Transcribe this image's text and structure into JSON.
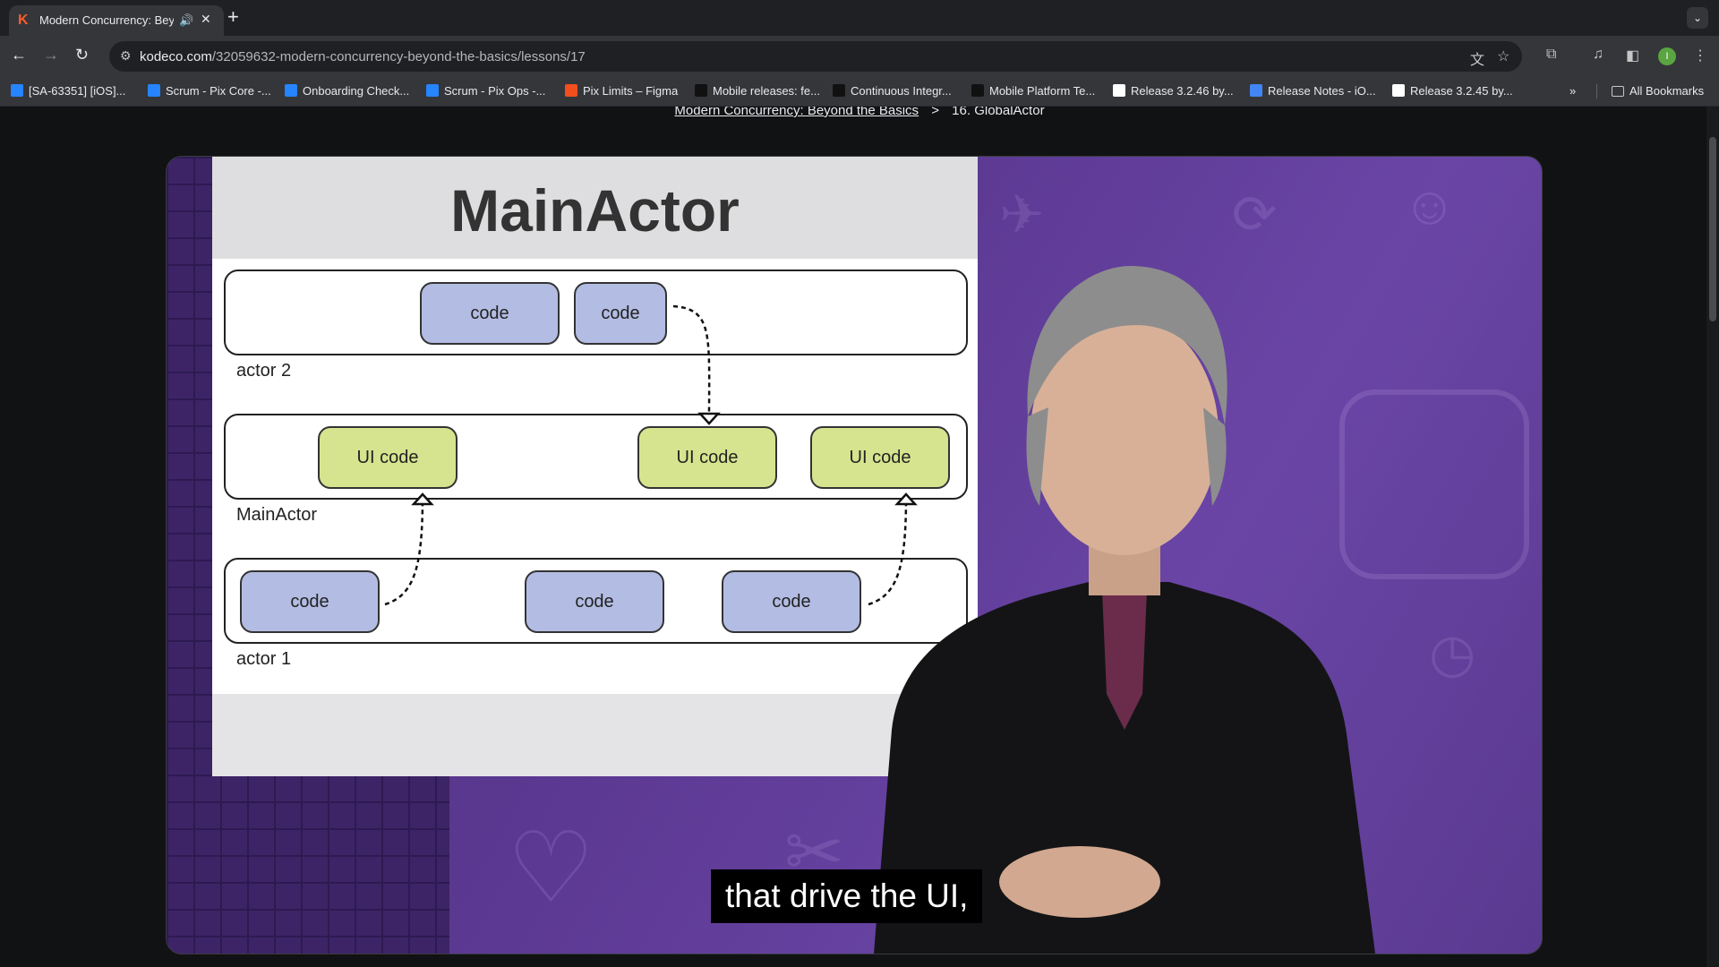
{
  "browser": {
    "tab": {
      "favicon": "K",
      "title": "Modern Concurrency: Bey",
      "audio_icon": "speaker-icon",
      "close_icon": "close-icon"
    },
    "new_tab_icon": "plus-icon",
    "tab_search_icon": "chevron-down-icon",
    "url_host": "kodeco.com",
    "url_path": "/32059632-modern-concurrency-beyond-the-basics/lessons/17",
    "profile_initial": "I",
    "profile_color": "#5aa541"
  },
  "bookmarks": [
    {
      "label": "[SA-63351] [iOS]...",
      "icon_color": "#2684ff"
    },
    {
      "label": "Scrum - Pix Core -...",
      "icon_color": "#2684ff"
    },
    {
      "label": "Onboarding Check...",
      "icon_color": "#2684ff"
    },
    {
      "label": "Scrum - Pix Ops -...",
      "icon_color": "#2684ff"
    },
    {
      "label": "Pix Limits – Figma",
      "icon_color": "#f24e1e"
    },
    {
      "label": "Mobile releases: fe...",
      "icon_color": "#111111"
    },
    {
      "label": "Continuous Integr...",
      "icon_color": "#111111"
    },
    {
      "label": "Mobile Platform Te...",
      "icon_color": "#111111"
    },
    {
      "label": "Release 3.2.46 by...",
      "icon_color": "#ffffff"
    },
    {
      "label": "Release Notes - iO...",
      "icon_color": "#4285f4"
    },
    {
      "label": "Release 3.2.45 by...",
      "icon_color": "#ffffff"
    }
  ],
  "bookmarks_more": "»",
  "all_bookmarks": "All Bookmarks",
  "breadcrumb": {
    "course": "Modern Concurrency: Beyond the Basics",
    "separator": ">",
    "lesson": "16. GlobalActor"
  },
  "slide": {
    "title": "MainActor",
    "actor2": {
      "label": "actor 2",
      "chips": [
        "code",
        "code"
      ]
    },
    "main_actor": {
      "label": "MainActor",
      "chips": [
        "UI code",
        "UI code",
        "UI code"
      ]
    },
    "actor1": {
      "label": "actor 1",
      "chips": [
        "code",
        "code",
        "code"
      ]
    },
    "colors": {
      "code": "#b3bde3",
      "ui_code": "#d6e48f"
    }
  },
  "caption": "that drive the UI,"
}
